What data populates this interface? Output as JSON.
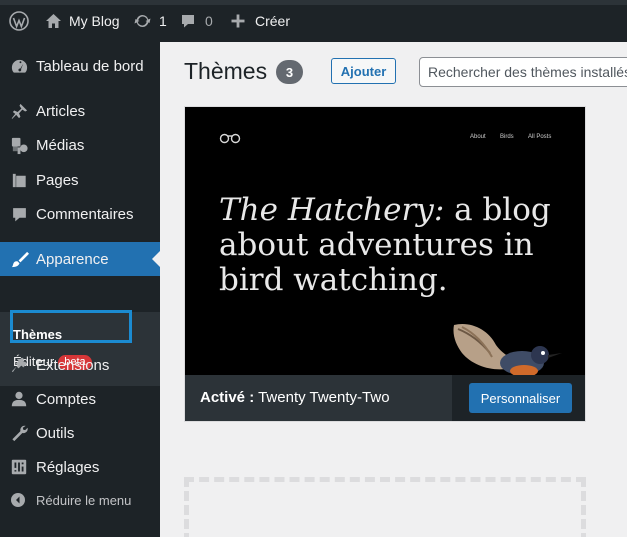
{
  "admin_bar": {
    "site_name": "My Blog",
    "updates_count": "1",
    "comments_count": "0",
    "new_label": "Créer"
  },
  "sidebar": {
    "items": [
      {
        "label": "Tableau de bord",
        "icon": "dashboard-icon"
      },
      {
        "label": "Articles",
        "icon": "pin-icon"
      },
      {
        "label": "Médias",
        "icon": "media-icon"
      },
      {
        "label": "Pages",
        "icon": "pages-icon"
      },
      {
        "label": "Commentaires",
        "icon": "comments-icon"
      },
      {
        "label": "Apparence",
        "icon": "brush-icon"
      },
      {
        "label": "Extensions",
        "icon": "plugin-icon"
      },
      {
        "label": "Comptes",
        "icon": "user-icon"
      },
      {
        "label": "Outils",
        "icon": "wrench-icon"
      },
      {
        "label": "Réglages",
        "icon": "settings-icon"
      }
    ],
    "submenu": {
      "themes_label": "Thèmes",
      "editor_label": "Éditeur",
      "editor_badge": "beta"
    },
    "collapse_label": "Réduire le menu"
  },
  "main": {
    "title": "Thèmes",
    "theme_count": "3",
    "add_button": "Ajouter",
    "search_placeholder": "Rechercher des thèmes installés"
  },
  "theme_card": {
    "preview": {
      "nav": [
        "About",
        "Birds",
        "All Posts"
      ],
      "headline_italic": "The Hatchery:",
      "headline_rest": " a blog about adventures in bird watching."
    },
    "active_prefix": "Activé :",
    "theme_name": "Twenty Twenty-Two",
    "customize_button": "Personnaliser"
  },
  "colors": {
    "admin_dark": "#1d2327",
    "accent_blue": "#2271b1",
    "badge_red": "#d63638",
    "focus_outline": "#1b8bd1"
  }
}
